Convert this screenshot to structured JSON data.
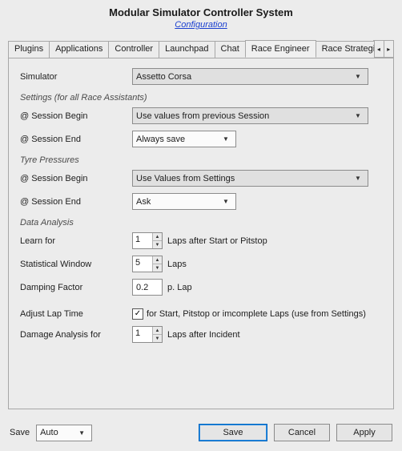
{
  "header": {
    "title": "Modular Simulator Controller System",
    "config_link": "Configuration"
  },
  "tabs": [
    "Plugins",
    "Applications",
    "Controller",
    "Launchpad",
    "Chat",
    "Race Engineer",
    "Race Strategis"
  ],
  "active_tab": "Race Engineer",
  "simulator": {
    "label": "Simulator",
    "value": "Assetto Corsa"
  },
  "settings_section": {
    "heading": "Settings (for all Race Assistants)",
    "session_begin_label": "@ Session Begin",
    "session_begin_value": "Use values from previous Session",
    "session_end_label": "@ Session End",
    "session_end_value": "Always save"
  },
  "tyre_section": {
    "heading": "Tyre Pressures",
    "session_begin_label": "@ Session Begin",
    "session_begin_value": "Use Values from Settings",
    "session_end_label": "@ Session End",
    "session_end_value": "Ask"
  },
  "data_analysis": {
    "heading": "Data Analysis",
    "learn_for_label": "Learn for",
    "learn_for_value": "1",
    "learn_for_suffix": "Laps after Start or Pitstop",
    "stat_window_label": "Statistical Window",
    "stat_window_value": "5",
    "stat_window_suffix": "Laps",
    "damping_label": "Damping Factor",
    "damping_value": "0.2",
    "damping_suffix": "p. Lap",
    "adjust_lap_label": "Adjust Lap Time",
    "adjust_lap_checked": true,
    "adjust_lap_suffix": "for Start, Pitstop or imcomplete Laps (use from Settings)",
    "damage_label": "Damage Analysis for",
    "damage_value": "1",
    "damage_suffix": "Laps after Incident"
  },
  "footer": {
    "save_mode_label": "Save",
    "save_mode_value": "Auto",
    "save_button": "Save",
    "cancel_button": "Cancel",
    "apply_button": "Apply"
  },
  "icons": {
    "chevron_down": "▼",
    "chevron_left": "◂",
    "chevron_right": "▸",
    "spin_up": "▲",
    "spin_down": "▼",
    "check": "✓"
  }
}
